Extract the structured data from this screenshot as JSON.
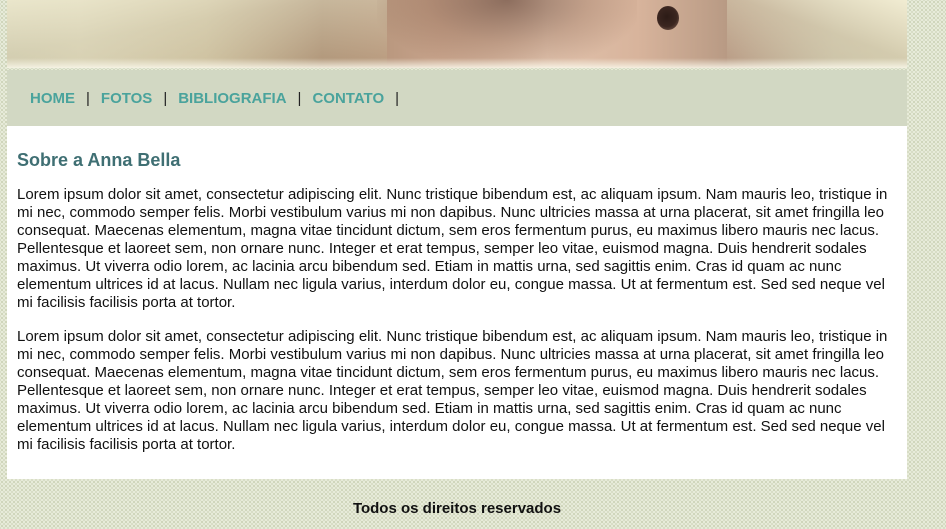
{
  "nav": {
    "items": [
      {
        "label": "HOME"
      },
      {
        "label": "FOTOS"
      },
      {
        "label": "BIBLIOGRAFIA"
      },
      {
        "label": "CONTATO"
      }
    ],
    "separator": "|"
  },
  "main": {
    "heading": "Sobre a Anna Bella",
    "paragraphs": [
      "Lorem ipsum dolor sit amet, consectetur adipiscing elit. Nunc tristique bibendum est, ac aliquam ipsum. Nam mauris leo, tristique in mi nec, commodo semper felis. Morbi vestibulum varius mi non dapibus. Nunc ultricies massa at urna placerat, sit amet fringilla leo consequat. Maecenas elementum, magna vitae tincidunt dictum, sem eros fermentum purus, eu maximus libero mauris nec lacus. Pellentesque et laoreet sem, non ornare nunc. Integer et erat tempus, semper leo vitae, euismod magna. Duis hendrerit sodales maximus. Ut viverra odio lorem, ac lacinia arcu bibendum sed. Etiam in mattis urna, sed sagittis enim. Cras id quam ac nunc elementum ultrices id at lacus. Nullam nec ligula varius, interdum dolor eu, congue massa. Ut at fermentum est. Sed sed neque vel mi facilisis facilisis porta at tortor.",
      "Lorem ipsum dolor sit amet, consectetur adipiscing elit. Nunc tristique bibendum est, ac aliquam ipsum. Nam mauris leo, tristique in mi nec, commodo semper felis. Morbi vestibulum varius mi non dapibus. Nunc ultricies massa at urna placerat, sit amet fringilla leo consequat. Maecenas elementum, magna vitae tincidunt dictum, sem eros fermentum purus, eu maximus libero mauris nec lacus. Pellentesque et laoreet sem, non ornare nunc. Integer et erat tempus, semper leo vitae, euismod magna. Duis hendrerit sodales maximus. Ut viverra odio lorem, ac lacinia arcu bibendum sed. Etiam in mattis urna, sed sagittis enim. Cras id quam ac nunc elementum ultrices id at lacus. Nullam nec ligula varius, interdum dolor eu, congue massa. Ut at fermentum est. Sed sed neque vel mi facilisis facilisis porta at tortor."
    ]
  },
  "footer": {
    "text": "Todos os direitos reservados"
  },
  "colors": {
    "nav_link": "#4aa39c",
    "heading": "#3f6f73",
    "nav_bg": "#d2d8c3",
    "page_bg": "#e7ebd9"
  }
}
